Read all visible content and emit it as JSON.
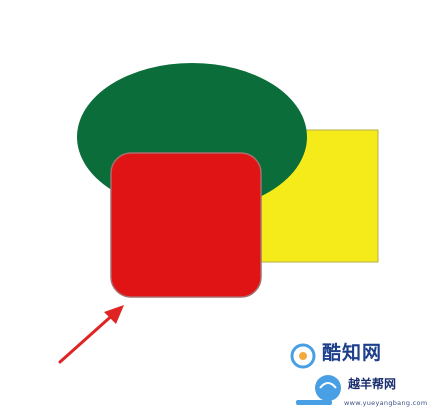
{
  "colors": {
    "background": "#ffffff",
    "ellipse_fill": "#0b6e3a",
    "rectangle_fill": "#f5ea1a",
    "rounded_square_fill": "#e01414",
    "arrow": "#e02424",
    "watermark_primary": "#1d3f8c",
    "watermark_accent": "#2a8fe0"
  },
  "shapes": [
    {
      "id": "ellipse",
      "kind": "ellipse",
      "color": "green"
    },
    {
      "id": "rectangle",
      "kind": "rectangle",
      "color": "yellow"
    },
    {
      "id": "rounded-square",
      "kind": "rounded-rectangle",
      "color": "red",
      "state": "selected-target"
    }
  ],
  "annotation": {
    "type": "arrow",
    "points_to": "rounded-square"
  },
  "watermark": {
    "brand": "酷知网",
    "secondary": "越羊帮网",
    "url": "www.yueyangbang.com"
  }
}
